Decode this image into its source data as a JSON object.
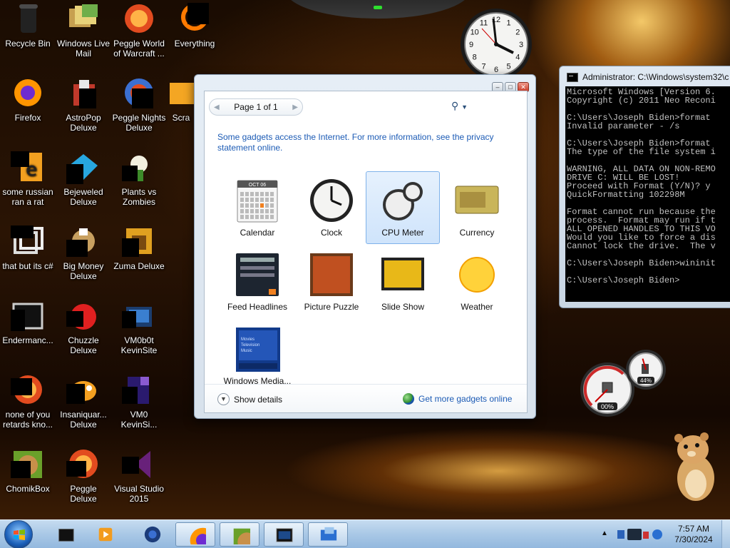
{
  "desktop": {
    "icons": [
      {
        "label": "Recycle Bin",
        "icon": "recycle-bin-icon"
      },
      {
        "label": "Windows Live Mail",
        "icon": "mail-icon"
      },
      {
        "label": "Peggle World of Warcraft ...",
        "icon": "peggle-icon"
      },
      {
        "label": "Everything",
        "icon": "search-orange-icon"
      },
      {
        "label": "Firefox",
        "icon": "firefox-icon"
      },
      {
        "label": "AstroPop Deluxe",
        "icon": "astropop-icon"
      },
      {
        "label": "Peggle Nights Deluxe",
        "icon": "peggle-nights-icon"
      },
      {
        "label": "Scra",
        "icon": "scratch-icon"
      },
      {
        "label": "some russian ran a rat",
        "icon": "file-icon"
      },
      {
        "label": "Bejeweled Deluxe",
        "icon": "bejeweled-icon"
      },
      {
        "label": "Plants vs Zombies",
        "icon": "plants-vs-zombies-icon"
      },
      {
        "label": "that but its c#",
        "icon": "shortcut-icon"
      },
      {
        "label": "Big Money Deluxe",
        "icon": "big-money-icon"
      },
      {
        "label": "Zuma Deluxe",
        "icon": "zuma-icon"
      },
      {
        "label": "Endermanc...",
        "icon": "app-window-icon"
      },
      {
        "label": "Chuzzle Deluxe",
        "icon": "chuzzle-icon"
      },
      {
        "label": "VM0b0t KevinSite",
        "icon": "vm-icon"
      },
      {
        "label": "none of you retards kno...",
        "icon": "peggle-icon"
      },
      {
        "label": "Insaniquar... Deluxe",
        "icon": "insaniquarium-icon"
      },
      {
        "label": "VM0 KevinSi...",
        "icon": "vm-purple-icon"
      },
      {
        "label": "ChomikBox",
        "icon": "chomikbox-icon"
      },
      {
        "label": "Peggle Deluxe",
        "icon": "peggle-icon"
      },
      {
        "label": "Visual Studio 2015",
        "icon": "visual-studio-icon"
      }
    ]
  },
  "clock_gadget": {
    "numerals": [
      "12",
      "1",
      "2",
      "3",
      "4",
      "5",
      "6",
      "7",
      "8",
      "9",
      "10",
      "11"
    ]
  },
  "gallery": {
    "page_label": "Page 1 of 1",
    "notice": "Some gadgets access the Internet.  For more information, see the privacy statement online.",
    "calendar_thumb_month": "OCT 06",
    "gadgets": [
      {
        "label": "Calendar",
        "icon": "calendar-icon",
        "selected": false
      },
      {
        "label": "Clock",
        "icon": "clock-icon",
        "selected": false
      },
      {
        "label": "CPU Meter",
        "icon": "cpu-meter-icon",
        "selected": true
      },
      {
        "label": "Currency",
        "icon": "currency-icon",
        "selected": false
      },
      {
        "label": "Feed Headlines",
        "icon": "feed-headlines-icon",
        "selected": false
      },
      {
        "label": "Picture Puzzle",
        "icon": "picture-puzzle-icon",
        "selected": false
      },
      {
        "label": "Slide Show",
        "icon": "slide-show-icon",
        "selected": false
      },
      {
        "label": "Weather",
        "icon": "weather-sun-icon",
        "selected": false
      },
      {
        "label": "Windows Media...",
        "icon": "windows-media-icon",
        "selected": false
      }
    ],
    "media_thumb_items": [
      "Movies",
      "Television",
      "Music"
    ],
    "show_details": "Show details",
    "get_more": "Get more gadgets online"
  },
  "console": {
    "title": "Administrator: C:\\Windows\\system32\\c",
    "lines": "Microsoft Windows [Version 6.\nCopyright (c) 2011 Neo Reconi\n\nC:\\Users\\Joseph Biden>format\nInvalid parameter - /s\n\nC:\\Users\\Joseph Biden>format\nThe type of the file system i\n\nWARNING, ALL DATA ON NON-REMO\nDRIVE C: WILL BE LOST!\nProceed with Format (Y/N)? y\nQuickFormatting 102298M\n\nFormat cannot run because the\nprocess.  Format may run if t\nALL OPENED HANDLES TO THIS VO\nWould you like to force a dis\nCannot lock the drive.  The v\n\nC:\\Users\\Joseph Biden>wininit\n\nC:\\Users\\Joseph Biden>"
  },
  "cpu_gadget": {
    "cpu": "00%",
    "memory": "44%",
    "cpu_percent": 0,
    "memory_percent": 44
  },
  "taskbar": {
    "buttons": [
      {
        "icon": "media-center-icon",
        "active": false
      },
      {
        "icon": "windows-media-player-icon",
        "active": false
      },
      {
        "icon": "world-icon",
        "active": false
      },
      {
        "icon": "firefox-icon",
        "active": true
      },
      {
        "icon": "chomikbox-icon",
        "active": true
      },
      {
        "icon": "cmd-icon",
        "active": true
      },
      {
        "icon": "gadgets-icon",
        "active": true
      }
    ],
    "time": "7:57 AM",
    "date": "7/30/2024"
  },
  "colors": {
    "link": "#1c5bb5",
    "taskbar": "#a9c8e6",
    "console_bg": "#000000",
    "console_fg": "#c0c0c0"
  }
}
